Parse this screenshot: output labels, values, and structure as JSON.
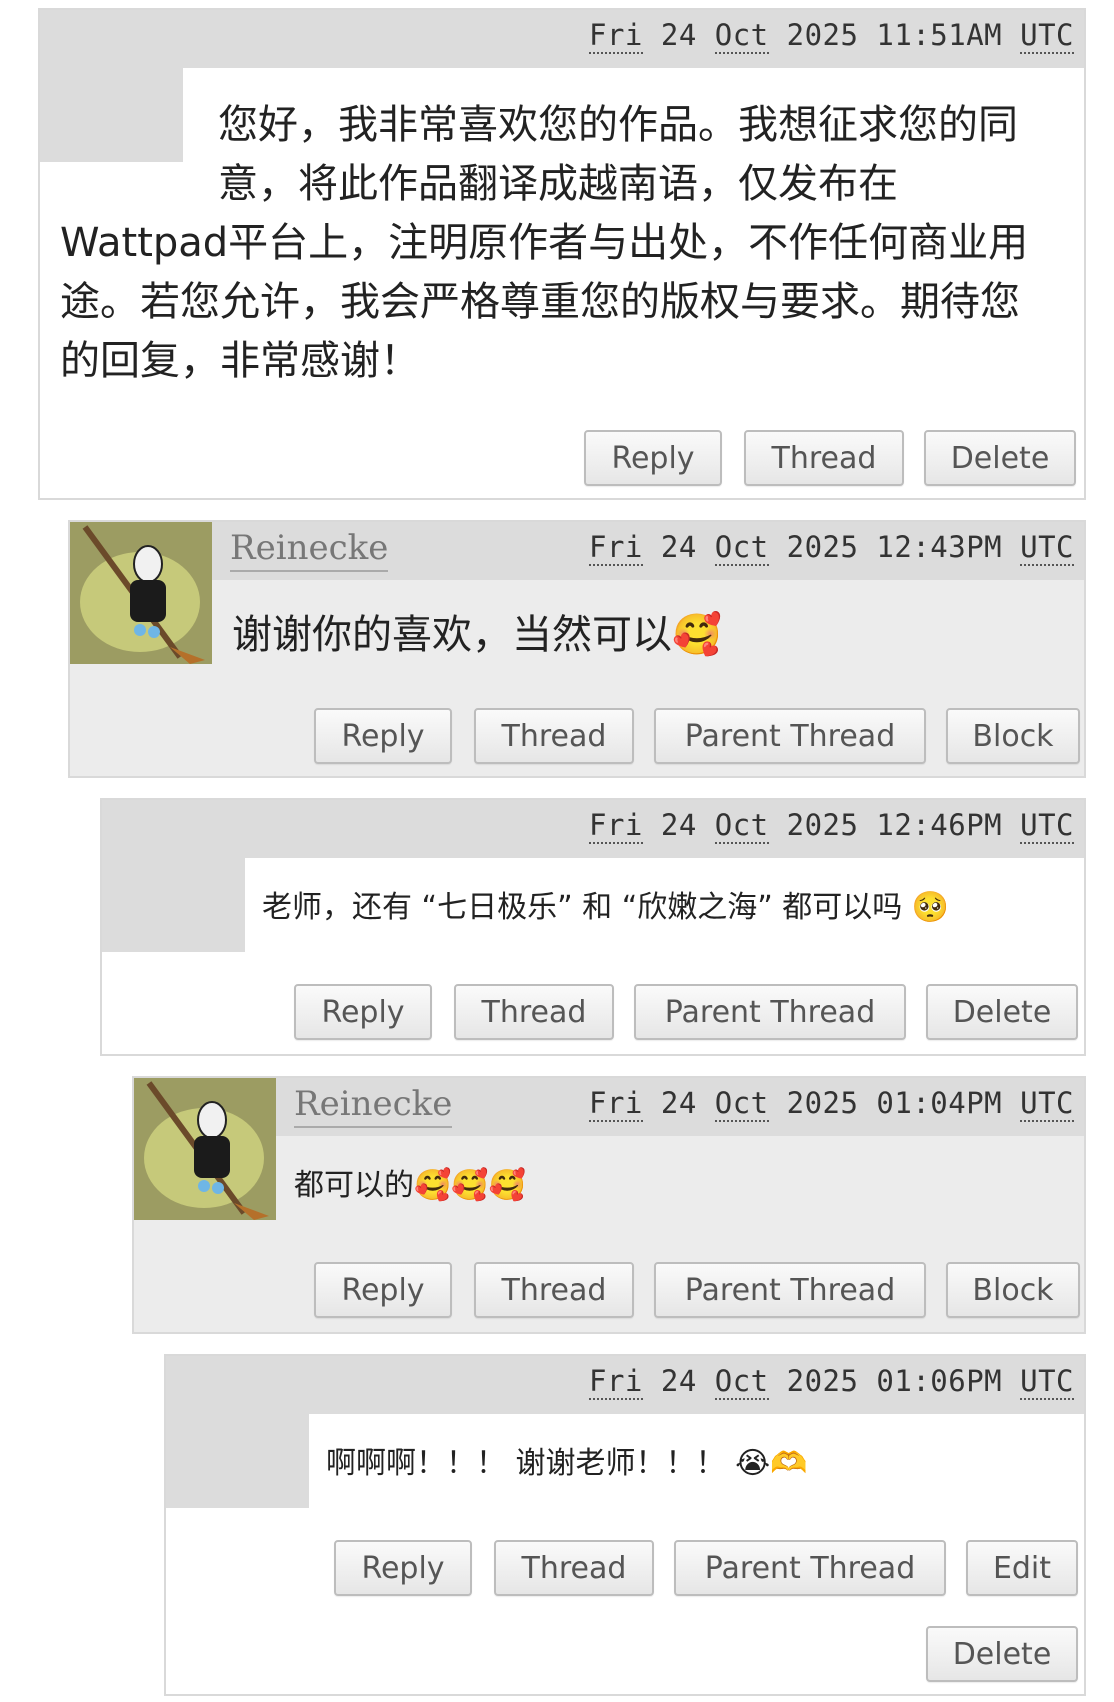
{
  "comments": [
    {
      "date": {
        "day": "Fri",
        "dom": "24",
        "month": "Oct",
        "year": "2025",
        "time": "11:51AM",
        "tz": "UTC"
      },
      "text_line1": "您好，我非常喜欢您的作品。我想征求您的同",
      "text_line2": "意，将此作品翻译成越南语，仅发布在",
      "text_line3": "Wattpad平台上，注明原作者与出处，不作任何商业用",
      "text_line4": "途。若您允许，我会严格尊重您的版权与要求。期待您",
      "text_line5": "的回复，非常感谢！",
      "buttons": [
        "Reply",
        "Thread",
        "Delete"
      ]
    },
    {
      "username": "Reinecke",
      "date": {
        "day": "Fri",
        "dom": "24",
        "month": "Oct",
        "year": "2025",
        "time": "12:43PM",
        "tz": "UTC"
      },
      "text": "谢谢你的喜欢，当然可以",
      "emoji": "🥰",
      "buttons": [
        "Reply",
        "Thread",
        "Parent Thread",
        "Block"
      ]
    },
    {
      "date": {
        "day": "Fri",
        "dom": "24",
        "month": "Oct",
        "year": "2025",
        "time": "12:46PM",
        "tz": "UTC"
      },
      "text": "老师，还有 “七日极乐” 和 “欣嫩之海” 都可以吗",
      "emoji": "🥺",
      "buttons": [
        "Reply",
        "Thread",
        "Parent Thread",
        "Delete"
      ]
    },
    {
      "username": "Reinecke",
      "date": {
        "day": "Fri",
        "dom": "24",
        "month": "Oct",
        "year": "2025",
        "time": "01:04PM",
        "tz": "UTC"
      },
      "text": "都可以的",
      "emoji": "🥰🥰🥰",
      "buttons": [
        "Reply",
        "Thread",
        "Parent Thread",
        "Block"
      ]
    },
    {
      "date": {
        "day": "Fri",
        "dom": "24",
        "month": "Oct",
        "year": "2025",
        "time": "01:06PM",
        "tz": "UTC"
      },
      "text": "啊啊啊！！！ 谢谢老师！！！",
      "emoji": "😭🫶",
      "buttons": [
        "Reply",
        "Thread",
        "Parent Thread",
        "Edit",
        "Delete"
      ]
    }
  ],
  "colors": {
    "header_bg": "#dcdcdc",
    "username": "#777777",
    "button_text": "#555555"
  }
}
